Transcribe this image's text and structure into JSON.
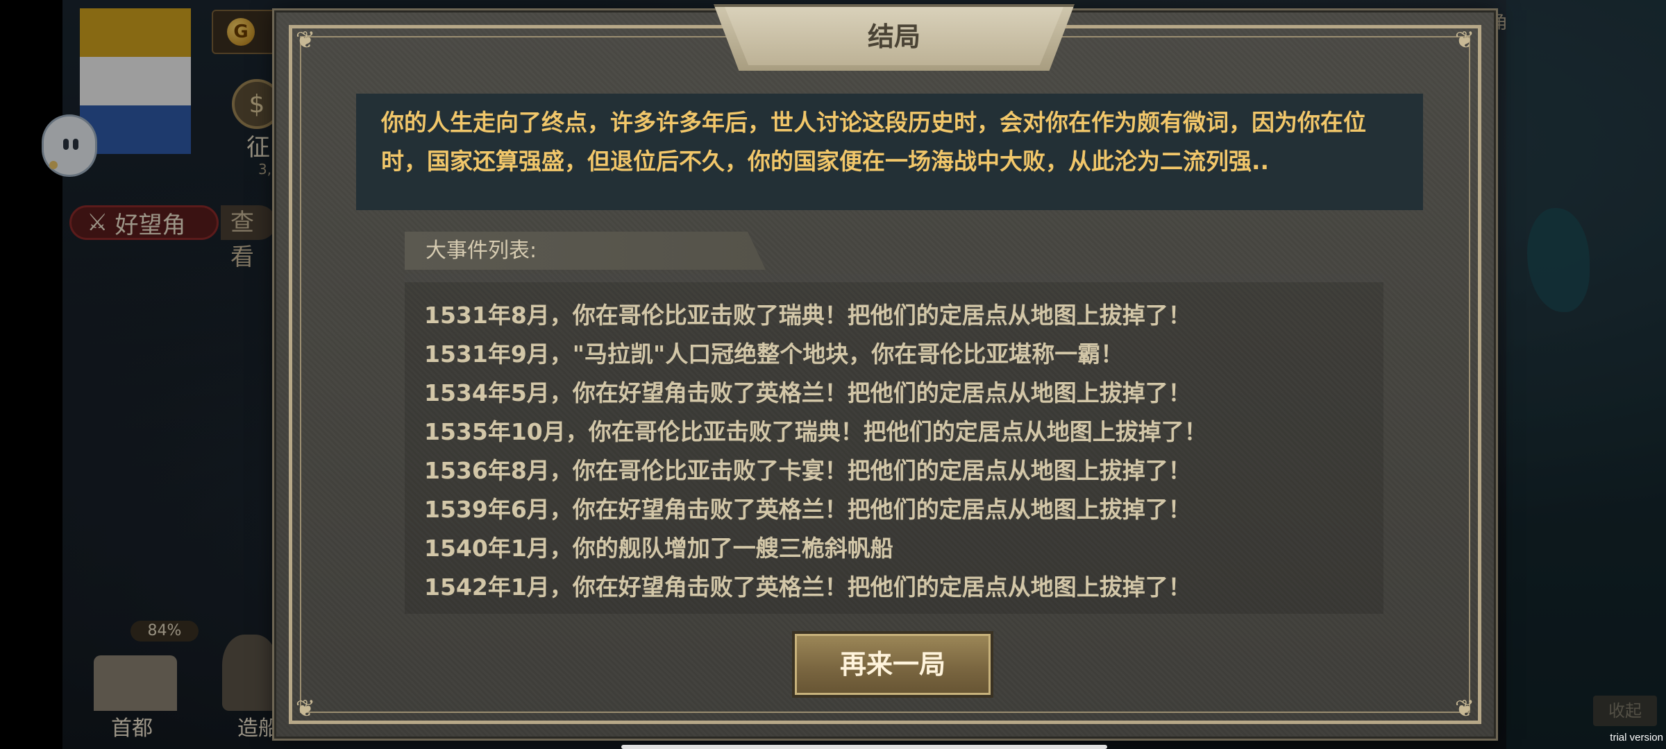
{
  "modal": {
    "title": "结局",
    "story_text": "你的人生走向了终点，许多许多年后，世人讨论这段历史时，会对你在作为颇有微词，因为你在位时，国家还算强盛，但退位后不久，你的国家便在一场海战中大败，从此沦为二流列强..",
    "events_header": "大事件列表:",
    "events": [
      "1531年8月，你在哥伦比亚击败了瑞典！把他们的定居点从地图上拔掉了！",
      "1531年9月，\"马拉凯\"人口冠绝整个地块，你在哥伦比亚堪称一霸！",
      "1534年5月，你在好望角击败了英格兰！把他们的定居点从地图上拔掉了！",
      "1535年10月，你在哥伦比亚击败了瑞典！把他们的定居点从地图上拔掉了！",
      "1536年8月，你在哥伦比亚击败了卡宴！把他们的定居点从地图上拔掉了！",
      "1539年6月，你在好望角击败了英格兰！把他们的定居点从地图上拔掉了！",
      "1540年1月，你的舰队增加了一艘三桅斜帆船",
      "1542年1月，你在好望角击败了英格兰！把他们的定居点从地图上拔掉了！"
    ],
    "restart_label": "再来一局"
  },
  "background": {
    "location_label": "好望角",
    "view_label": "查看",
    "laurel_label": "征",
    "laurel_sub": "3,",
    "coin_glyph": "G",
    "capital_label": "首都",
    "capital_percent": "84%",
    "ship_label": "造船",
    "ocean_label": "之角",
    "collapse_label": "收起",
    "trial_label": "trial version"
  },
  "colors": {
    "story_text": "#f2c76a",
    "story_bg": "#233036",
    "event_text": "#d3c7a8",
    "button": "#7b6741"
  }
}
